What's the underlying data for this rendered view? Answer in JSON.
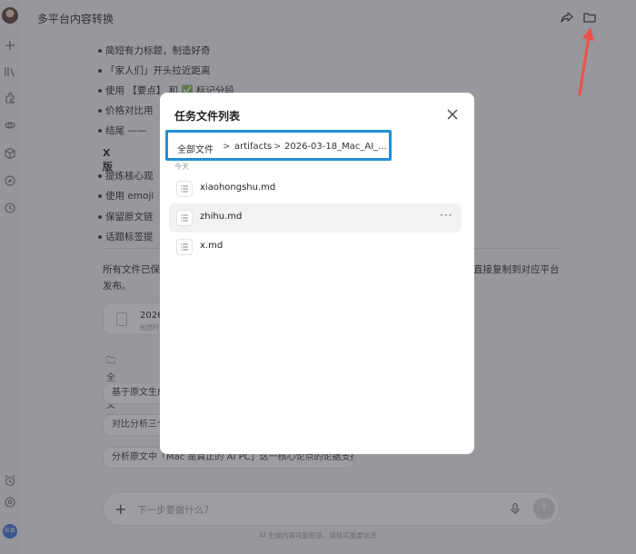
{
  "header": {
    "title": "多平台内容转换"
  },
  "content": {
    "bullets_top": [
      "简短有力标题，制造好奇",
      "「家人们」开头拉近距离",
      "使用 【要点】 和 ✅ 标记分段",
      "价格对比用",
      "结尾 ——"
    ],
    "section_x": "X版",
    "bullets_x": [
      "提炼核心观",
      "使用 emoji",
      "保留原文链",
      "话题标签提"
    ],
    "summary_line1_left": "所有文件已保",
    "summary_line1_right": "直接复制到对应平台",
    "summary_line2": "发布。",
    "file_card": {
      "title": "2026",
      "sub": "创建时"
    },
    "folder_link": "全部文件",
    "suggestions": [
      "基于原文生成",
      "对比分析三个",
      "分析原文中「Mac 是真正的 AI PC」这一核心论点的论据支撑"
    ]
  },
  "input": {
    "placeholder": "下一步要做什么?"
  },
  "footer_note": "AI 生成内容可能有误，请核实重要信息",
  "sidebar_user": "杜易",
  "modal": {
    "title": "任务文件列表",
    "breadcrumb": [
      "全部文件",
      "artifacts",
      "2026-03-18_Mac_AI_..."
    ],
    "breadcrumb_sep": ">",
    "group_label": "今天",
    "files": [
      "xiaohongshu.md",
      "zhihu.md",
      "x.md"
    ],
    "more": "···"
  },
  "colors": {
    "highlight": "#1f8fd6",
    "annotation_arrow": "#f0504a",
    "check_green": "#4caf50"
  }
}
